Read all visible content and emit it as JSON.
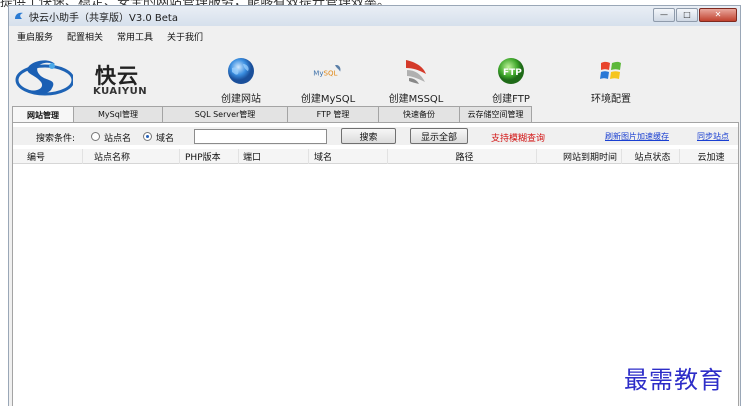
{
  "bleed_text": "提供了快速、稳定、安全的网站管理服务，能够有效提升管理效率。",
  "window": {
    "title": "快云小助手（共享版）V3.0 Beta",
    "controls": [
      "minimize-icon",
      "maximize-icon",
      "close-icon"
    ]
  },
  "menu": [
    {
      "label": "重启服务"
    },
    {
      "label": "配置相关"
    },
    {
      "label": "常用工具"
    },
    {
      "label": "关于我们"
    }
  ],
  "logo": {
    "cn": "快云",
    "en": "KUAIYUN"
  },
  "toolbar": [
    {
      "label": "创建网站",
      "icon": "globe-icon"
    },
    {
      "label": "创建MySQL",
      "icon": "mysql-dolphin-icon"
    },
    {
      "label": "创建MSSQL",
      "icon": "mssql-icon"
    },
    {
      "label": "创建FTP",
      "icon": "ftp-icon"
    },
    {
      "label": "环境配置",
      "icon": "windows-flag-icon"
    }
  ],
  "tabs": [
    {
      "label": "网站管理",
      "active": true
    },
    {
      "label": "MySql管理",
      "active": false
    },
    {
      "label": "SQL Server管理",
      "active": false
    },
    {
      "label": "FTP 管理",
      "active": false
    },
    {
      "label": "快速备份",
      "active": false
    },
    {
      "label": "云存储空间管理",
      "active": false
    }
  ],
  "search": {
    "condition_label": "搜索条件:",
    "radio_site_name": "站点名",
    "radio_domain": "域名",
    "selected": "域名",
    "input_value": "",
    "search_button": "搜索",
    "show_all_button": "显示全部",
    "fuzzy_hint": "支持模糊查询",
    "link_refresh_cache": "刷新图片加速缓存",
    "link_sync_sites": "同步站点"
  },
  "grid": {
    "columns": [
      "编号",
      "站点名称",
      "PHP版本",
      "端口",
      "域名",
      "路径",
      "网站到期时间",
      "站点状态",
      "云加速"
    ],
    "rows": []
  },
  "watermark": "最需教育",
  "colors": {
    "accent_blue": "#2460b8",
    "hint_red": "#d21414",
    "link_blue": "#1a3fd1",
    "watermark_blue": "#2d2dc8"
  }
}
